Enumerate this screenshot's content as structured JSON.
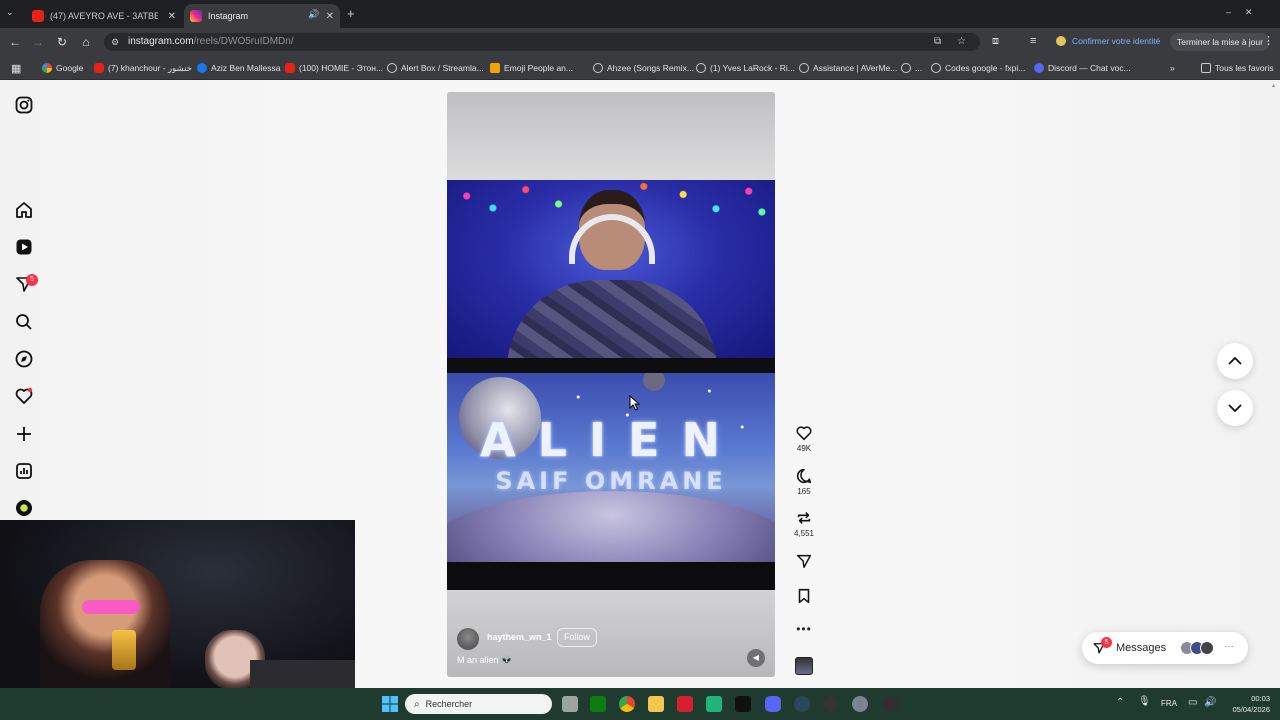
{
  "browser": {
    "tabs": [
      {
        "title": "(47) AVEYRO AVE - 3ATBET SEN",
        "active": false
      },
      {
        "title": "Instagram",
        "active": true
      }
    ],
    "url_host": "instagram.com",
    "url_path": "/reels/DWO5ruIDMDn/",
    "identity_label": "Confirmer votre identité",
    "update_label": "Terminer la mise à jour",
    "bookmarks": [
      "Google",
      "(7) khanchour - خنشور",
      "Aziz Ben Mallessa",
      "(100) HOMIE - Этон...",
      "Alert Box / Streamla...",
      "Emoji People an...",
      "Ahzee (Songs Remix...",
      "(1) Yves LaRock - Ri...",
      "Assistance | AVerMe...",
      "...",
      "Codes google - fxpi...",
      "Discord — Chat voc..."
    ],
    "all_bookmarks": "Tous les favoris"
  },
  "sidebar": {
    "notification_badge": "5"
  },
  "reel": {
    "title_line1": "ALIEN",
    "title_line2": "SAIF OMRANE",
    "username": "haythem_wn_1",
    "follow_label": "Follow",
    "caption": "M an alien 👽"
  },
  "actions": {
    "likes": "49K",
    "comments": "165",
    "reposts": "4,551"
  },
  "messages": {
    "label": "Messages",
    "badge": "5"
  },
  "taskbar": {
    "search_placeholder": "Rechercher",
    "language": "FRA",
    "time": "00:03",
    "date": "05/04/2026"
  }
}
